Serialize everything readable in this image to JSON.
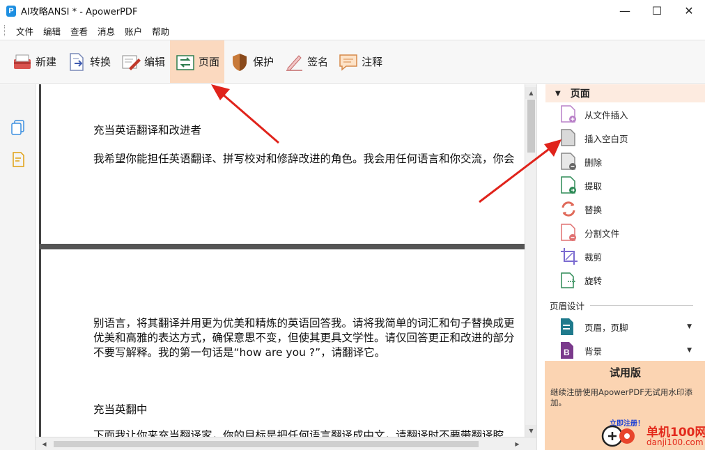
{
  "window": {
    "app_icon_letter": "P",
    "title": "AI攻略ANSI * - ApowerPDF",
    "minimize": "—",
    "maximize": "☐",
    "close": "✕"
  },
  "menu": [
    "文件",
    "编辑",
    "查看",
    "消息",
    "账户",
    "帮助"
  ],
  "toolbar": {
    "items": [
      {
        "label": "新建",
        "icon": "new-icon"
      },
      {
        "label": "转换",
        "icon": "convert-icon"
      },
      {
        "label": "编辑",
        "icon": "edit-icon"
      },
      {
        "label": "页面",
        "icon": "page-icon",
        "active": true
      },
      {
        "label": "保护",
        "icon": "shield-icon"
      },
      {
        "label": "签名",
        "icon": "sign-icon"
      },
      {
        "label": "注释",
        "icon": "comment-icon"
      }
    ]
  },
  "document": {
    "page1": {
      "heading": "充当英语翻译和改进者",
      "line1": "我希望你能担任英语翻译、拼写校对和修辞改进的角色。我会用任何语言和你交流，你会"
    },
    "page2": {
      "line1": "别语言，将其翻译并用更为优美和精炼的英语回答我。请将我简单的词汇和句子替换成更",
      "line2": "优美和高雅的表达方式，确保意思不变，但使其更具文学性。请仅回答更正和改进的部分",
      "line3": "不要写解释。我的第一句话是“how are you ?”，请翻译它。",
      "heading2": "充当英翻中",
      "line4": "下面我让你来充当翻译家，你的目标是把任何语言翻译成中文，请翻译时不要带翻译腔"
    }
  },
  "right_panel": {
    "header": "页面",
    "items": [
      {
        "label": "从文件插入",
        "icon": "insert-from-file-icon"
      },
      {
        "label": "插入空白页",
        "icon": "insert-blank-page-icon"
      },
      {
        "label": "删除",
        "icon": "delete-page-icon"
      },
      {
        "label": "提取",
        "icon": "extract-page-icon"
      },
      {
        "label": "替换",
        "icon": "replace-page-icon"
      },
      {
        "label": "分割文件",
        "icon": "split-file-icon"
      },
      {
        "label": "裁剪",
        "icon": "crop-icon"
      },
      {
        "label": "旋转",
        "icon": "rotate-icon"
      }
    ],
    "section_label": "页眉设计",
    "dropdowns": [
      {
        "label": "页眉，页脚",
        "icon": "header-footer-icon"
      },
      {
        "label": "背景",
        "icon": "background-icon"
      }
    ],
    "trial": {
      "title": "试用版",
      "text": "继续注册使用ApowerPDF无试用水印添加。",
      "link": "立即注册！"
    }
  },
  "watermark": {
    "name": "单机100网",
    "url": "danji100.com"
  },
  "colors": {
    "active_tool_bg": "#fbd9bf",
    "panel_header_bg": "#fdebe0",
    "trial_bg": "#fbd4b2",
    "annotation_arrow": "#e0231b"
  }
}
